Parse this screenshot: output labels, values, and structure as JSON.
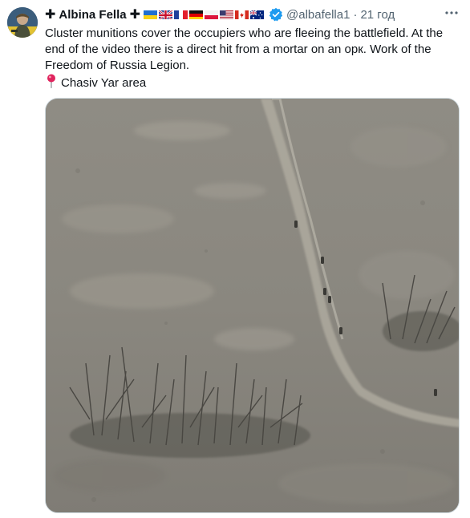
{
  "author": {
    "cross_left": "✚",
    "name": "Albina Fella",
    "cross_right": "✚",
    "flags": [
      "ukraine-flag",
      "uk-flag",
      "france-flag",
      "germany-flag",
      "poland-flag",
      "usa-flag",
      "canada-flag",
      "australia-flag"
    ],
    "verified_icon": "verified-badge-icon",
    "handle": "@albafella1",
    "separator": "·",
    "time": "21 год"
  },
  "tweet": {
    "text": "Cluster munitions cover the occupiers who are fleeing the battlefield. At the end of the video there is a direct hit from a mortar on an орк. Work of the Freedom of Russia Legion.",
    "location_icon": "round-pushpin-icon",
    "location": "Chasiv Yar area"
  },
  "menu": {
    "icon": "more-icon",
    "label": "···"
  },
  "colors": {
    "text": "#0f1419",
    "secondary": "#536471",
    "verified": "#1d9bf0",
    "border": "#cfd9de"
  }
}
